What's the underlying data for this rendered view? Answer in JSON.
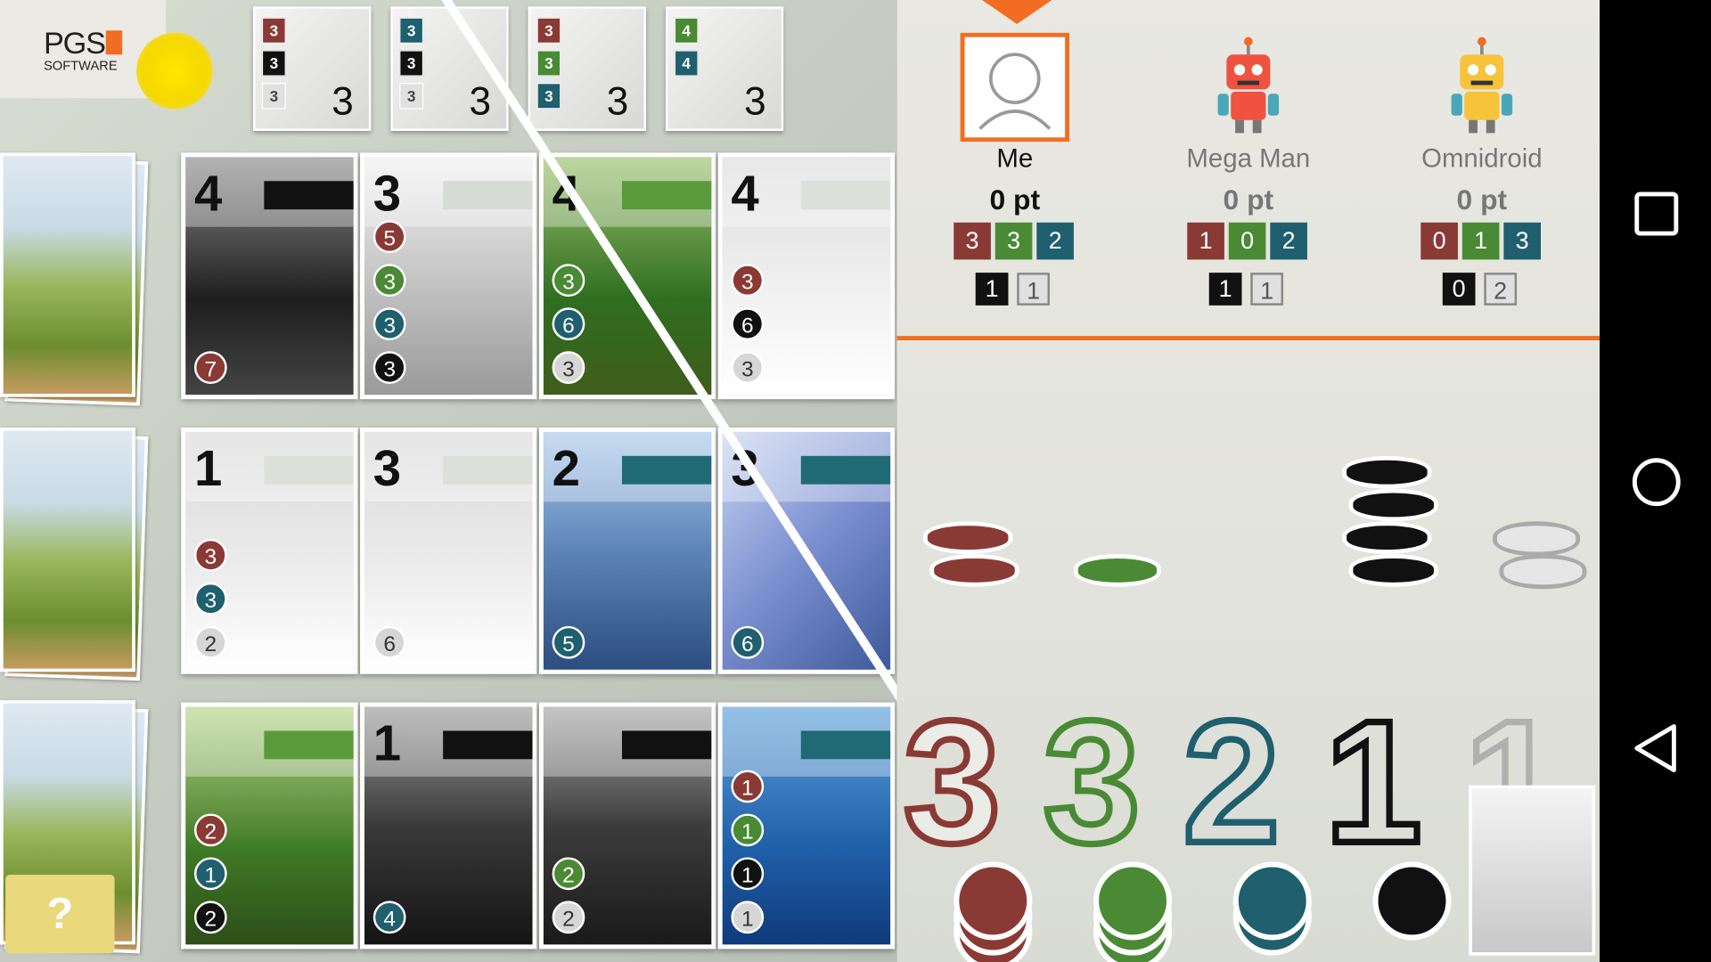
{
  "logo": {
    "brand": "PGS",
    "sub": "SOFTWARE"
  },
  "nobles": [
    {
      "pts": "3",
      "req": [
        {
          "v": "3",
          "c": "#8a3a34"
        },
        {
          "v": "3",
          "c": "#111111"
        },
        {
          "v": "3",
          "c": "#e0e0e0"
        }
      ]
    },
    {
      "pts": "3",
      "req": [
        {
          "v": "3",
          "c": "#1f5f6e"
        },
        {
          "v": "3",
          "c": "#111111"
        },
        {
          "v": "3",
          "c": "#e0e0e0"
        }
      ]
    },
    {
      "pts": "3",
      "req": [
        {
          "v": "3",
          "c": "#8a3a34"
        },
        {
          "v": "3",
          "c": "#4a8a35"
        },
        {
          "v": "3",
          "c": "#1f5f6e"
        }
      ]
    },
    {
      "pts": "3",
      "req": [
        {
          "v": "4",
          "c": "#4a8a35"
        },
        {
          "v": "4",
          "c": "#1f5f6e"
        }
      ]
    }
  ],
  "cards": [
    {
      "row": 0,
      "col": 0,
      "pt": "4",
      "bonus": "#111111",
      "bg": "linear-gradient(180deg,#8a8a8a,#1e1e1e 60%,#444)",
      "cost": [
        {
          "v": "7",
          "c": "#8a3a34"
        }
      ]
    },
    {
      "row": 0,
      "col": 1,
      "pt": "3",
      "bonus": "#d6dbd6",
      "bg": "linear-gradient(180deg,#f0f0f0,#bdbdbd 60%,#9a9a9a)",
      "cost": [
        {
          "v": "5",
          "c": "#8a3a34"
        },
        {
          "v": "3",
          "c": "#4a8a35"
        },
        {
          "v": "3",
          "c": "#1f5f6e"
        },
        {
          "v": "3",
          "c": "#111111"
        }
      ]
    },
    {
      "row": 0,
      "col": 2,
      "pt": "4",
      "bonus": "#5b9a3a",
      "bg": "linear-gradient(180deg,#9bbf6c,#2f6e20 60%,#3f5d1c)",
      "cost": [
        {
          "v": "3",
          "c": "#4a8a35"
        },
        {
          "v": "6",
          "c": "#1f5f6e"
        },
        {
          "v": "3",
          "c": "#d6d6d6"
        }
      ]
    },
    {
      "row": 0,
      "col": 3,
      "pt": "4",
      "bonus": "#dde0da",
      "bg": "linear-gradient(180deg,#dcdcdc,#f2f2f2 60%,#ffffff)",
      "cost": [
        {
          "v": "3",
          "c": "#8a3a34"
        },
        {
          "v": "6",
          "c": "#111111"
        },
        {
          "v": "3",
          "c": "#d6d6d6"
        }
      ]
    },
    {
      "row": 1,
      "col": 0,
      "pt": "1",
      "bonus": "#dde0da",
      "bg": "linear-gradient(180deg,#d9d9d9,#ededed 60%,#ffffff)",
      "cost": [
        {
          "v": "3",
          "c": "#8a3a34"
        },
        {
          "v": "3",
          "c": "#1f5f6e"
        },
        {
          "v": "2",
          "c": "#d6d6d6"
        }
      ]
    },
    {
      "row": 1,
      "col": 1,
      "pt": "3",
      "bonus": "#dde0da",
      "bg": "linear-gradient(180deg,#d9d9d9,#ededed 60%,#ffffff)",
      "cost": [
        {
          "v": "6",
          "c": "#d6d6d6"
        }
      ]
    },
    {
      "row": 1,
      "col": 2,
      "pt": "2",
      "bonus": "#1f6a74",
      "bg": "linear-gradient(180deg,#a8c8ea,#5d84b8 50%,#2c4d80)",
      "cost": [
        {
          "v": "5",
          "c": "#1f5f6e"
        }
      ]
    },
    {
      "row": 1,
      "col": 3,
      "pt": "3",
      "bonus": "#1f6a74",
      "bg": "linear-gradient(135deg,#c7d4f0,#7b8fd0 50%,#3e5a9a)",
      "cost": [
        {
          "v": "6",
          "c": "#1f5f6e"
        }
      ]
    },
    {
      "row": 2,
      "col": 0,
      "pt": "",
      "bonus": "#5b9a3a",
      "bg": "linear-gradient(180deg,#b7d48a,#3f7a24 60%,#2d4e1a)",
      "cost": [
        {
          "v": "2",
          "c": "#8a3a34"
        },
        {
          "v": "1",
          "c": "#1f5f6e"
        },
        {
          "v": "2",
          "c": "#111111"
        }
      ]
    },
    {
      "row": 2,
      "col": 1,
      "pt": "1",
      "bonus": "#111111",
      "bg": "linear-gradient(180deg,#9a9a9a,#3a3a3a 50%,#141414)",
      "cost": [
        {
          "v": "4",
          "c": "#1f5f6e"
        }
      ]
    },
    {
      "row": 2,
      "col": 2,
      "pt": "",
      "bonus": "#111111",
      "bg": "linear-gradient(180deg,#a5a5a5,#3c3c3c 50%,#1a1a1a)",
      "cost": [
        {
          "v": "2",
          "c": "#4a8a35"
        },
        {
          "v": "2",
          "c": "#d6d6d6"
        }
      ]
    },
    {
      "row": 2,
      "col": 3,
      "pt": "",
      "bonus": "#1f6a74",
      "bg": "linear-gradient(180deg,#5b9fd9,#1f5fa8 60%,#0f3a7a)",
      "cost": [
        {
          "v": "1",
          "c": "#8a3a34"
        },
        {
          "v": "1",
          "c": "#4a8a35"
        },
        {
          "v": "1",
          "c": "#111111"
        },
        {
          "v": "1",
          "c": "#d6d6d6"
        }
      ]
    }
  ],
  "help": {
    "label": "?"
  },
  "players": [
    {
      "name": "Me",
      "score": "0 pt",
      "gems": [
        {
          "v": "3",
          "c": "#8a3a34"
        },
        {
          "v": "3",
          "c": "#4a8a35"
        },
        {
          "v": "2",
          "c": "#1f5f6e"
        }
      ],
      "res": [
        {
          "v": "1",
          "c": "#111111",
          "t": "#ffffff"
        },
        {
          "v": "1",
          "c": "#e0e0e0",
          "t": "#555555"
        }
      ],
      "nameColor": "#111111",
      "scoreColor": "#111111"
    },
    {
      "name": "Mega Man",
      "score": "0 pt",
      "gems": [
        {
          "v": "1",
          "c": "#8a3a34"
        },
        {
          "v": "0",
          "c": "#4a8a35"
        },
        {
          "v": "2",
          "c": "#1f5f6e"
        }
      ],
      "res": [
        {
          "v": "1",
          "c": "#111111",
          "t": "#ffffff"
        },
        {
          "v": "1",
          "c": "#e0e0e0",
          "t": "#555555"
        }
      ],
      "nameColor": "#777777",
      "scoreColor": "#777777"
    },
    {
      "name": "Omnidroid",
      "score": "0 pt",
      "gems": [
        {
          "v": "0",
          "c": "#8a3a34"
        },
        {
          "v": "1",
          "c": "#4a8a35"
        },
        {
          "v": "3",
          "c": "#1f5f6e"
        }
      ],
      "res": [
        {
          "v": "0",
          "c": "#111111",
          "t": "#ffffff"
        },
        {
          "v": "2",
          "c": "#e0e0e0",
          "t": "#555555"
        }
      ],
      "nameColor": "#777777",
      "scoreColor": "#777777"
    }
  ],
  "bank": [
    {
      "v": "3",
      "c": "#8a3a34"
    },
    {
      "v": "3",
      "c": "#4a8a35"
    },
    {
      "v": "2",
      "c": "#1f5f6e"
    },
    {
      "v": "1",
      "c": "#111111"
    },
    {
      "v": "1",
      "c": "#b0b0b0"
    }
  ],
  "colors": {
    "accent": "#f26d21",
    "red": "#8a3a34",
    "green": "#4a8a35",
    "teal": "#1f5f6e",
    "black": "#111111",
    "white": "#e0e0e0"
  }
}
